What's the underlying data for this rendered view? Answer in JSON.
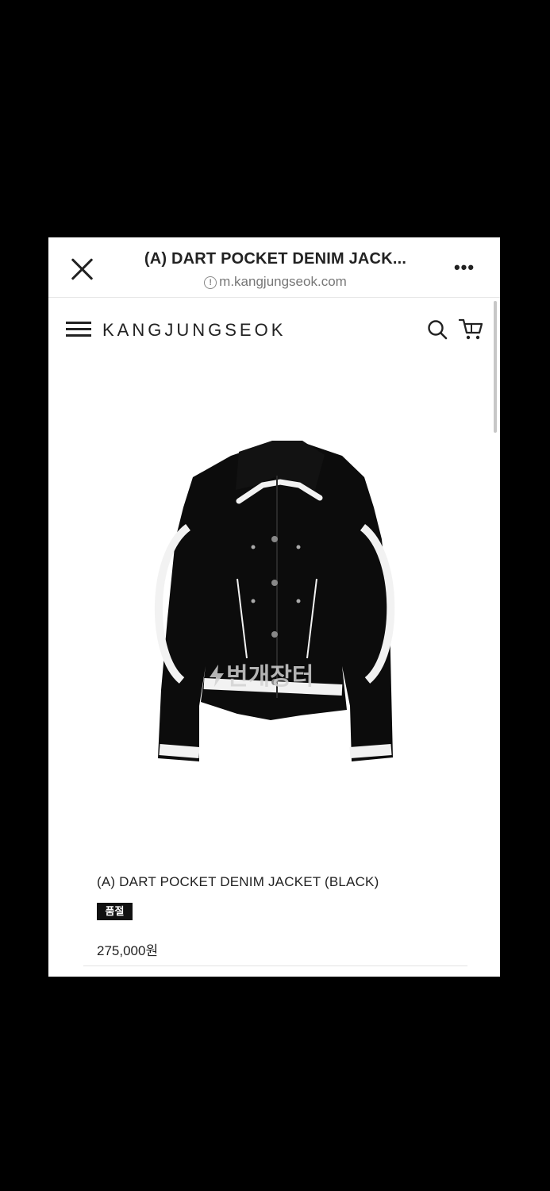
{
  "browser": {
    "tab_title": "(A) DART POCKET DENIM JACK...",
    "url": "m.kangjungseok.com",
    "info_glyph": "!",
    "more_label": "•••"
  },
  "site": {
    "brand": "KANGJUNGSEOK"
  },
  "product": {
    "name": "(A) DART POCKET DENIM JACKET (BLACK)",
    "badge": "품절",
    "price": "275,000원",
    "watermark": "번개장터"
  },
  "icons": [
    "close-icon",
    "info-icon",
    "more-icon",
    "menu-icon",
    "search-icon",
    "cart-icon",
    "bolt-icon"
  ],
  "colors": {
    "background": "#000000",
    "page": "#ffffff",
    "text": "#222222",
    "badge_bg": "#111111",
    "jacket": "#0c0c0c",
    "trim": "#f2f2f2"
  }
}
